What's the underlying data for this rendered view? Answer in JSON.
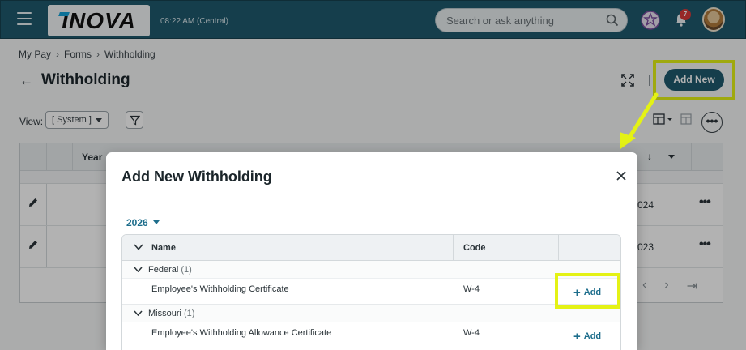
{
  "header": {
    "logo_text": "INOVA",
    "clock": "08:22 AM (Central)",
    "search_placeholder": "Search or ask anything",
    "notification_count": "7"
  },
  "breadcrumb": [
    "My Pay",
    "Forms",
    "Withholding"
  ],
  "page": {
    "title": "Withholding",
    "add_new_label": "Add New",
    "view_label": "View:",
    "view_value": "[ System ]"
  },
  "grid": {
    "columns": [
      "Year"
    ],
    "rows": [
      {
        "year_fragment": "024"
      },
      {
        "year_fragment": "023"
      }
    ]
  },
  "modal": {
    "title": "Add New Withholding",
    "year": "2026",
    "columns": {
      "name": "Name",
      "code": "Code"
    },
    "groups": [
      {
        "label": "Federal",
        "count": "(1)",
        "items": [
          {
            "name": "Employee's Withholding Certificate",
            "code": "W-4",
            "action": "Add"
          }
        ]
      },
      {
        "label": "Missouri",
        "count": "(1)",
        "items": [
          {
            "name": "Employee's Withholding Allowance Certificate",
            "code": "W-4",
            "action": "Add"
          }
        ]
      }
    ]
  },
  "colors": {
    "brand": "#1f5a6e",
    "link": "#1e6e8c",
    "highlight": "#e4f215",
    "badge": "#d83a3a"
  }
}
